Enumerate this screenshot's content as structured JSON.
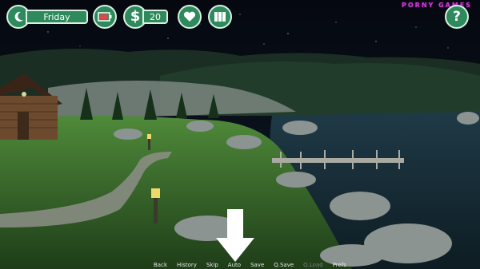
{
  "hud": {
    "day": "Friday",
    "money": "20",
    "brand": "PORNY GAMES"
  },
  "icons": {
    "time_of_day": "moon-icon",
    "battery": "battery-icon",
    "money": "dollar-icon",
    "relationships": "heart-icon",
    "journal": "book-icon",
    "help": "help-icon",
    "navigation": "down-arrow-icon"
  },
  "quick_menu": {
    "items": [
      {
        "label": "Back",
        "enabled": true
      },
      {
        "label": "History",
        "enabled": true
      },
      {
        "label": "Skip",
        "enabled": true
      },
      {
        "label": "Auto",
        "enabled": true
      },
      {
        "label": "Save",
        "enabled": true
      },
      {
        "label": "Q.Save",
        "enabled": true
      },
      {
        "label": "Q.Load",
        "enabled": false
      },
      {
        "label": "Prefs",
        "enabled": true
      }
    ]
  },
  "colors": {
    "hud_green": "#2e8a5c",
    "hud_border": "#d9f0e2",
    "brand_magenta": "#d43ad6"
  }
}
